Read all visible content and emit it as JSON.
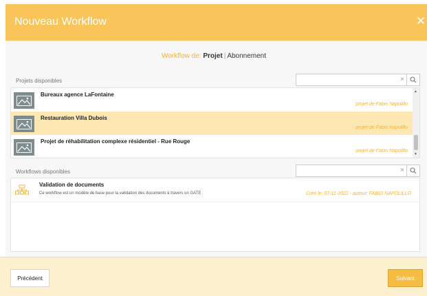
{
  "dialog": {
    "title": "Nouveau Workflow",
    "close_icon": "close-icon"
  },
  "workflow_type": {
    "label": "Workflow de:",
    "active_option": "Projet",
    "separator": "|",
    "other_option": "Abonnement"
  },
  "projects": {
    "section_label": "Projets disponibles",
    "search_value": "",
    "clear_glyph": "×",
    "items": [
      {
        "name": "Bureaux agence LaFontaine",
        "owner": "projet de Fabio Napolillo",
        "selected": false
      },
      {
        "name": "Restauration Villa Dubois",
        "owner": "projet de Fabio Napolillo",
        "selected": true
      },
      {
        "name": "Projet de réhabilitation complexe résidentiel - Rue Rouge",
        "owner": "projet de Fabio Napolillo",
        "selected": false
      }
    ],
    "scroll_position_fraction": 0.72
  },
  "workflows": {
    "section_label": "Workflows disponibles",
    "search_value": "",
    "clear_glyph": "×",
    "items": [
      {
        "name": "Validation de documents",
        "description": "Ce workflow est un modèle de base pour la validation des documents à travers un GATE",
        "meta": "Créé le: 07-11-2022 - auteur: FABIO NAPOLILLO"
      }
    ]
  },
  "footer": {
    "previous_label": "Précédent",
    "next_label": "Suivant"
  },
  "colors": {
    "accent": "#f9c55a",
    "accent_text": "#f4b231",
    "selected_row": "#fde8b3",
    "footer_bg": "#fdf0cf"
  }
}
